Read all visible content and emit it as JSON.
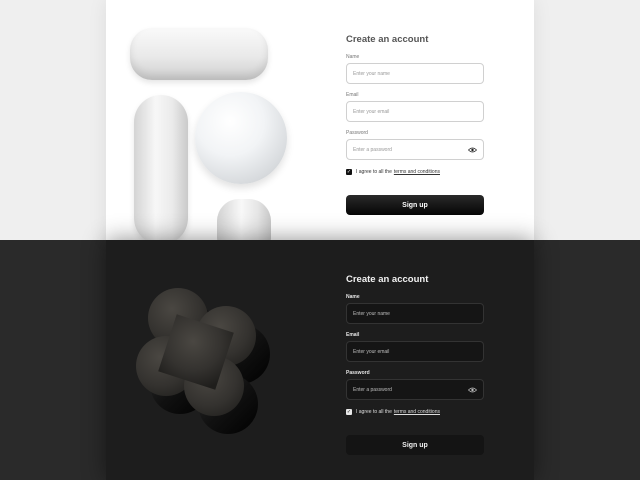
{
  "light": {
    "title": "Create an account",
    "name_label": "Name",
    "name_placeholder": "Enter your name",
    "email_label": "Email",
    "email_placeholder": "Enter your email",
    "password_label": "Password",
    "password_placeholder": "Enter a password",
    "agree_text": "I agree to all the",
    "agree_link": "terms and conditions",
    "agree_checked": true,
    "button": "Sign up"
  },
  "dark": {
    "title": "Create an account",
    "name_label": "Name",
    "name_placeholder": "Enter your name",
    "email_label": "Email",
    "email_placeholder": "Enter your email",
    "password_label": "Password",
    "password_placeholder": "Enter a password",
    "agree_text": "I agree to all the",
    "agree_link": "terms and conditions",
    "agree_checked": true,
    "button": "Sign up"
  },
  "icons": {
    "password_toggle": "eye-icon",
    "checkbox_mark": "✓"
  },
  "colors": {
    "light_bg": "#efefef",
    "light_panel": "#ffffff",
    "dark_bg": "#2a2a2a",
    "dark_panel": "#1d1d1d",
    "button_dark": "#111111"
  }
}
